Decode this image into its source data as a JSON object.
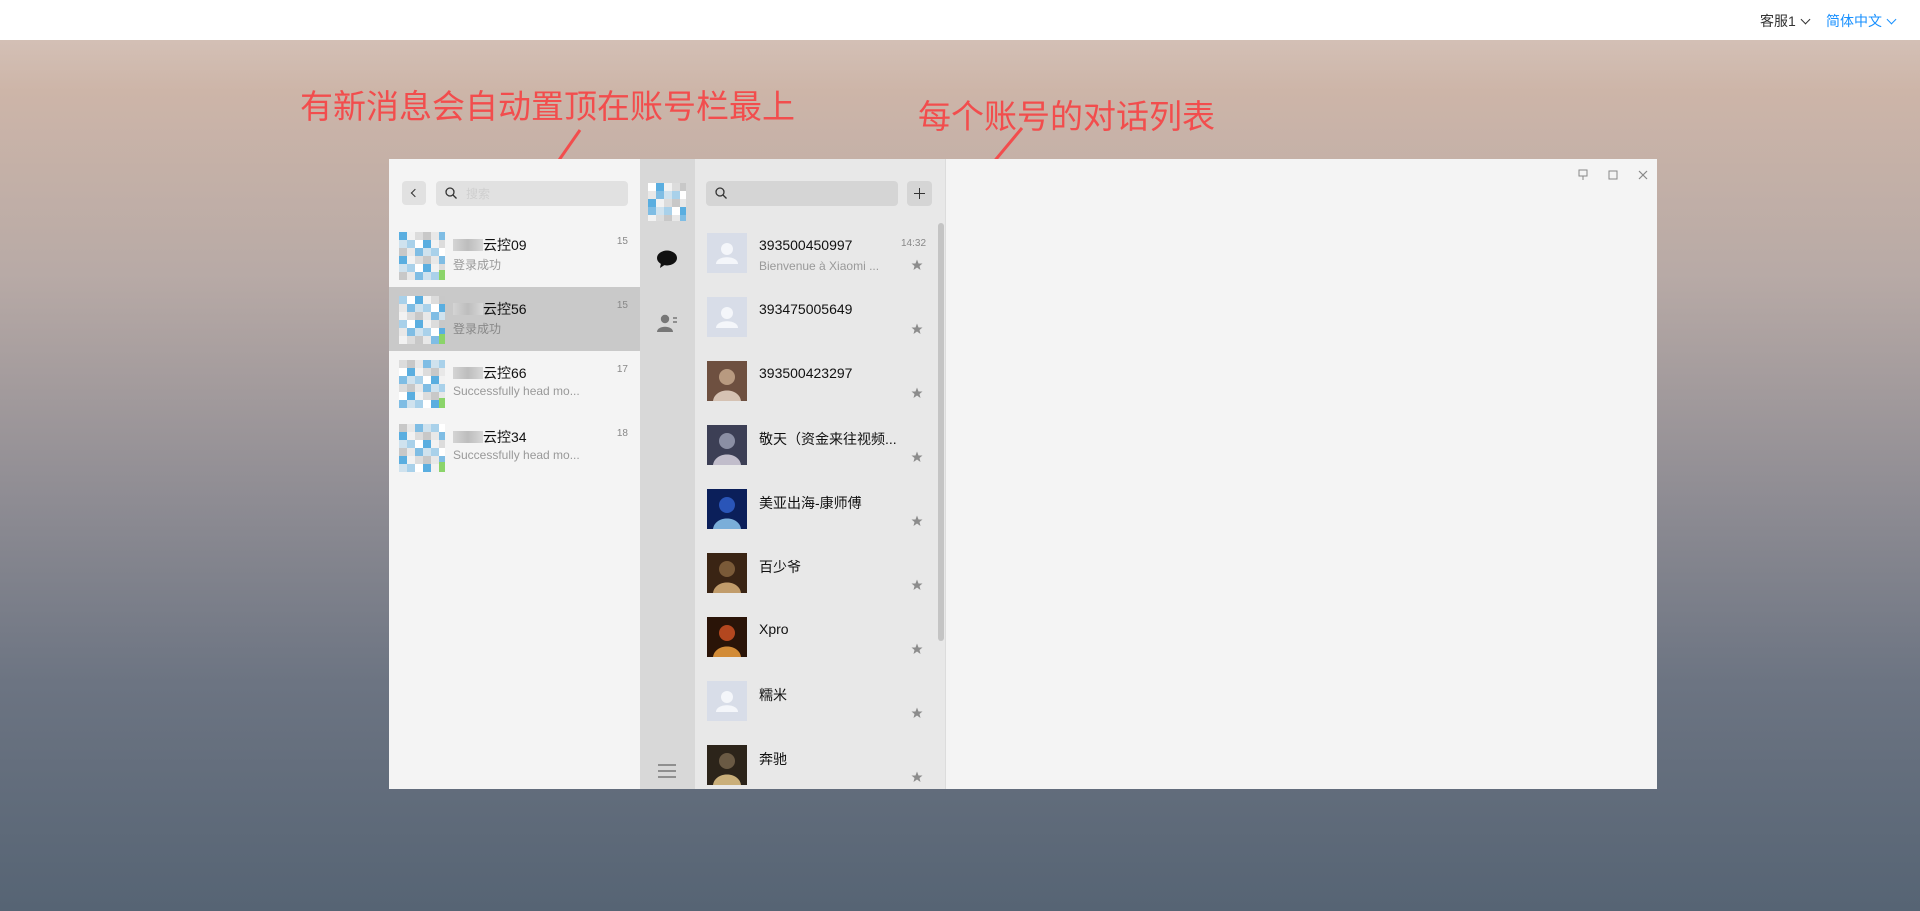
{
  "topbar": {
    "customer_service": "客服1",
    "language": "简体中文"
  },
  "annotations": {
    "pin_note": "有新消息会自动置顶在账号栏最上",
    "conversation_note": "每个账号的对话列表"
  },
  "colors": {
    "annotation": "#f24d4d",
    "language_link": "#1890ff",
    "online_indicator": "#8bd46a"
  },
  "account_panel": {
    "search_placeholder": "搜索",
    "accounts": [
      {
        "name": "云控09",
        "message": "登录成功",
        "badge": "15",
        "selected": false
      },
      {
        "name": "云控56",
        "message": "登录成功",
        "badge": "15",
        "selected": true
      },
      {
        "name": "云控66",
        "message": "Successfully head mo...",
        "badge": "17",
        "selected": false
      },
      {
        "name": "云控34",
        "message": "Successfully head mo...",
        "badge": "18",
        "selected": false
      }
    ]
  },
  "nav": {
    "chat_icon": "chat-bubble-icon",
    "contacts_icon": "contacts-icon",
    "menu_icon": "hamburger-menu-icon"
  },
  "conversations": [
    {
      "name": "393500450997",
      "message": "Bienvenue à Xiaomi ...",
      "time": "14:32",
      "avatar": "default"
    },
    {
      "name": "393475005649",
      "message": "",
      "time": "",
      "avatar": "default"
    },
    {
      "name": "393500423297",
      "message": "",
      "time": "",
      "avatar": "photo"
    },
    {
      "name": "敬天（资金来往视频...",
      "message": "",
      "time": "",
      "avatar": "photo"
    },
    {
      "name": "美亚出海-康师傅",
      "message": "",
      "time": "",
      "avatar": "photo"
    },
    {
      "name": "百少爷",
      "message": "",
      "time": "",
      "avatar": "photo"
    },
    {
      "name": "Xpro",
      "message": "",
      "time": "",
      "avatar": "photo"
    },
    {
      "name": "糯米",
      "message": "",
      "time": "",
      "avatar": "default"
    },
    {
      "name": "奔驰",
      "message": "",
      "time": "",
      "avatar": "photo"
    }
  ]
}
